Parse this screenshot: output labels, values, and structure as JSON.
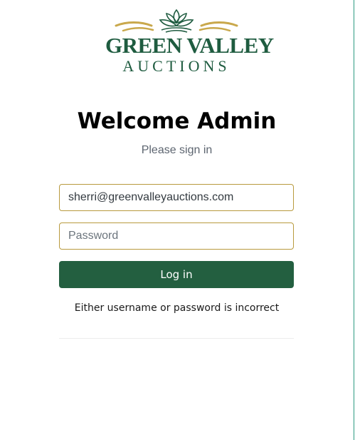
{
  "brand": {
    "name_line1": "GREEN VALLEY",
    "name_line2": "AUCTIONS",
    "primary_color": "#1f5c40",
    "accent_color": "#c9a84c"
  },
  "login": {
    "title": "Welcome Admin",
    "subtitle": "Please sign in",
    "email_value": "sherri@greenvalleyauctions.com",
    "password_placeholder": "Password",
    "submit_label": "Log in",
    "error_message": "Either username or password is incorrect",
    "button_color": "#235f40",
    "field_border_color": "#b89a3e"
  }
}
